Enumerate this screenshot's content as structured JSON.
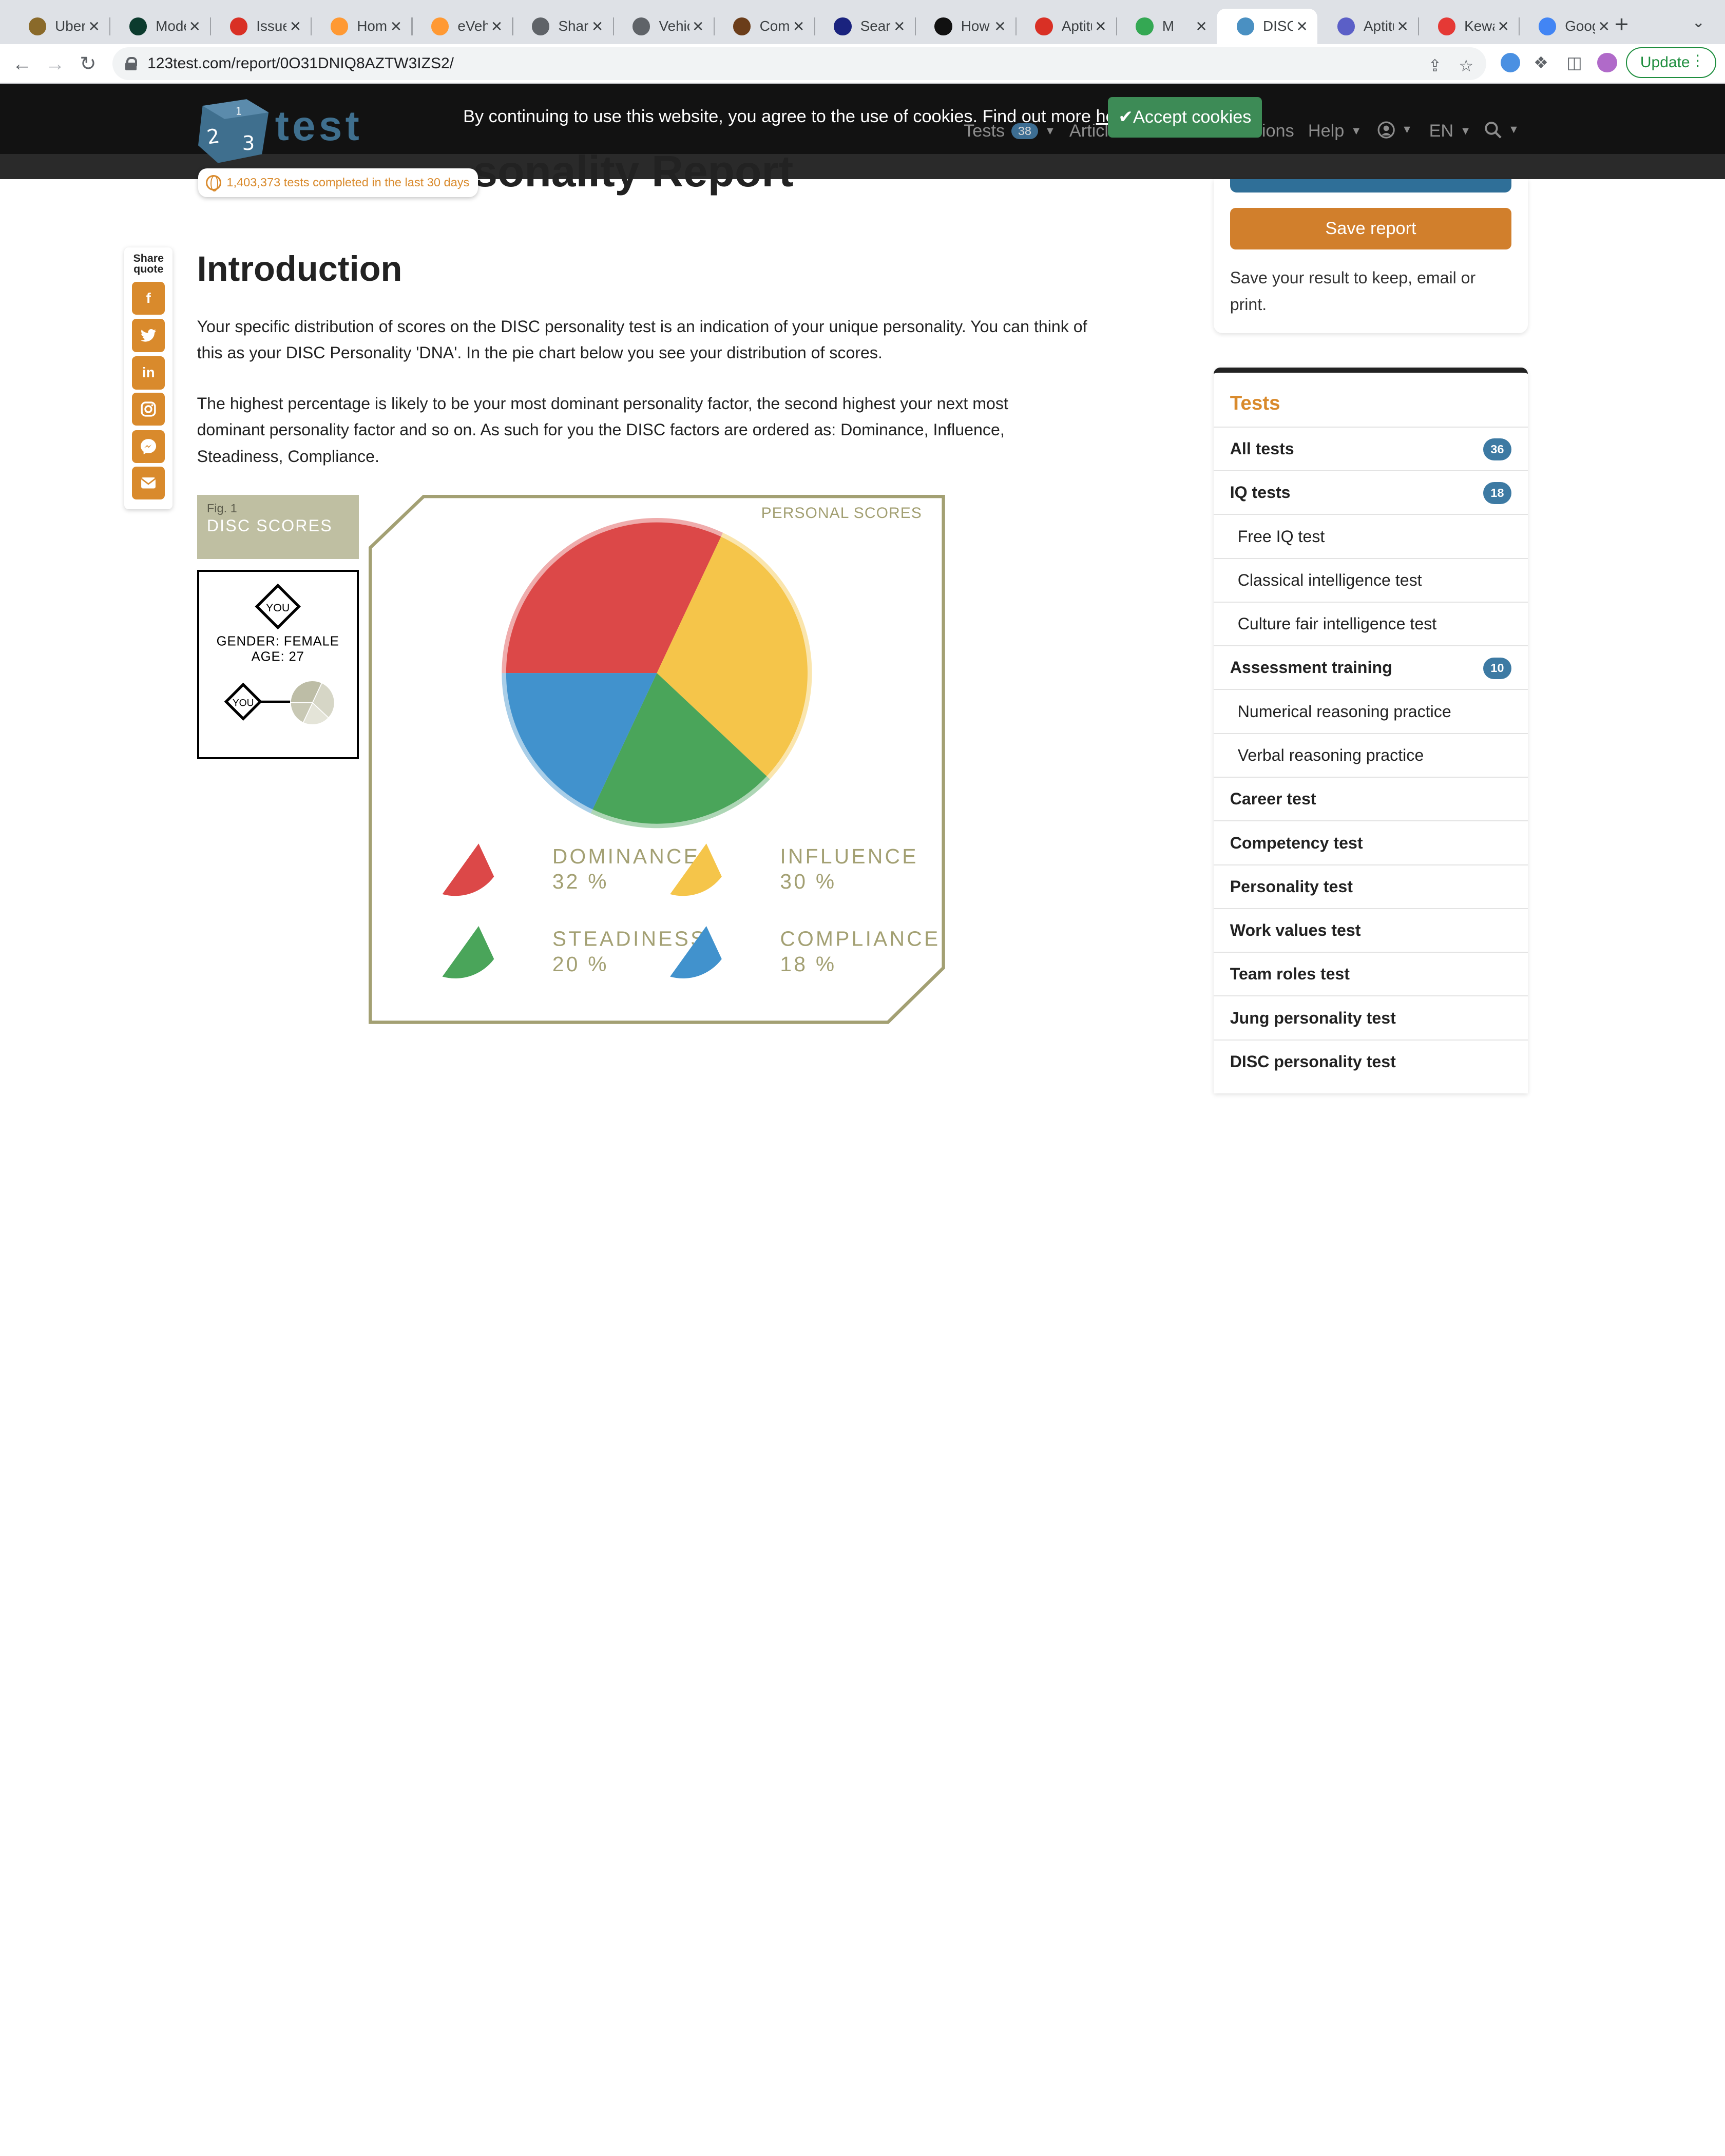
{
  "browser": {
    "tabs": [
      {
        "label": "Uberc",
        "fav_color": "#8a6a2a"
      },
      {
        "label": "Mode",
        "fav_color": "#0c3b2e"
      },
      {
        "label": "Issue",
        "fav_color": "#d93025"
      },
      {
        "label": "Home",
        "fav_color": "#ff9933"
      },
      {
        "label": "eVehi",
        "fav_color": "#ff9933"
      },
      {
        "label": "Share",
        "fav_color": "#5f6368"
      },
      {
        "label": "Vehic",
        "fav_color": "#5f6368"
      },
      {
        "label": "Comir",
        "fav_color": "#6b3d1a"
      },
      {
        "label": "Searc",
        "fav_color": "#1a237e"
      },
      {
        "label": "How t",
        "fav_color": "#111111"
      },
      {
        "label": "Aptitu",
        "fav_color": "#d93025"
      },
      {
        "label": "M",
        "fav_color": "#34a853"
      },
      {
        "label": "DISC",
        "fav_color": "#4a90c2"
      },
      {
        "label": "Aptitu",
        "fav_color": "#5b5fc7"
      },
      {
        "label": "Kewa",
        "fav_color": "#e53935"
      },
      {
        "label": "Goog",
        "fav_color": "#4285f4"
      }
    ],
    "url": "123test.com/report/0O31DNIQ8AZTW3IZS2/",
    "update_label": "Update"
  },
  "header": {
    "logo_text": "test",
    "cookie_message": "By continuing to use this website, you agree to the use of cookies. Find out more ",
    "cookie_link": "here",
    "cookie_period": ".",
    "accept_label": "Accept cookies",
    "nav": {
      "tests": "Tests",
      "tests_count": "38",
      "articles": "Articl",
      "questions": "ions",
      "help": "Help",
      "lang": "EN"
    },
    "counter": "1,403,373 tests completed in the last 30 days",
    "page_title_partial": "sonality Report"
  },
  "share": {
    "label_line1": "Share",
    "label_line2": "quote"
  },
  "main": {
    "heading": "Introduction",
    "para1": "Your specific distribution of scores on the DISC personality test is an indication of your unique personality. You can think of this as your DISC Personality 'DNA'. In the pie chart below you see your distribution of scores.",
    "para2": "The highest percentage is likely to be your most dominant personality factor, the second highest your next most dominant personality factor and so on. As such for you the DISC factors are ordered as: Dominance, Influence, Steadiness, Compliance.",
    "figure": {
      "fig_number": "Fig. 1",
      "fig_title": "DISC SCORES",
      "you_label": "YOU",
      "gender_line": "GENDER: FEMALE",
      "age_line": "AGE: 27",
      "chart_title": "PERSONAL SCORES"
    }
  },
  "chart_data": {
    "type": "pie",
    "title": "PERSONAL SCORES",
    "slices": [
      {
        "label": "DOMINANCE",
        "value": 32,
        "value_text": "32 %",
        "color": "#dc4848"
      },
      {
        "label": "INFLUENCE",
        "value": 30,
        "value_text": "30 %",
        "color": "#f5c54a"
      },
      {
        "label": "STEADINESS",
        "value": 20,
        "value_text": "20 %",
        "color": "#4aa55a"
      },
      {
        "label": "COMPLIANCE",
        "value": 18,
        "value_text": "18 %",
        "color": "#4192cd"
      }
    ]
  },
  "sidebar": {
    "save_label": "Save report",
    "save_note": "Save your result to keep, email or print.",
    "tests_title": "Tests",
    "items": [
      {
        "label": "All tests",
        "badge": "36",
        "kind": "bold"
      },
      {
        "label": "IQ tests",
        "badge": "18",
        "kind": "bold"
      },
      {
        "label": "Free IQ test",
        "badge": "",
        "kind": "sub"
      },
      {
        "label": "Classical intelligence test",
        "badge": "",
        "kind": "sub"
      },
      {
        "label": "Culture fair intelligence test",
        "badge": "",
        "kind": "sub"
      },
      {
        "label": "Assessment training",
        "badge": "10",
        "kind": "bold"
      },
      {
        "label": "Numerical reasoning practice",
        "badge": "",
        "kind": "sub"
      },
      {
        "label": "Verbal reasoning practice",
        "badge": "",
        "kind": "sub"
      },
      {
        "label": "Career test",
        "badge": "",
        "kind": "bold"
      },
      {
        "label": "Competency test",
        "badge": "",
        "kind": "bold"
      },
      {
        "label": "Personality test",
        "badge": "",
        "kind": "bold"
      },
      {
        "label": "Work values test",
        "badge": "",
        "kind": "bold"
      },
      {
        "label": "Team roles test",
        "badge": "",
        "kind": "bold"
      },
      {
        "label": "Jung personality test",
        "badge": "",
        "kind": "bold"
      },
      {
        "label": "DISC personality test",
        "badge": "",
        "kind": "bold"
      }
    ]
  }
}
